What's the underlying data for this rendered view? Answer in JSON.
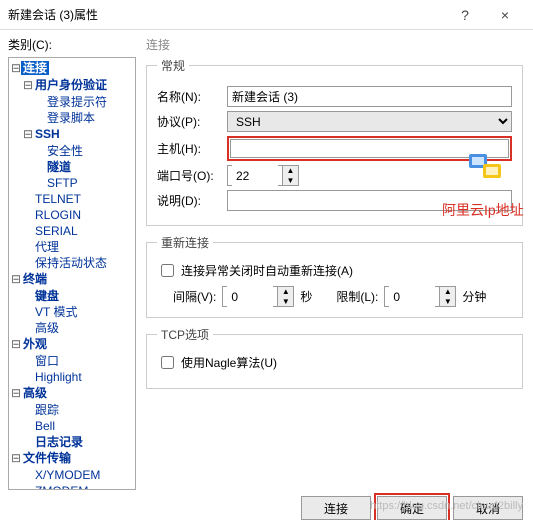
{
  "window": {
    "title": "新建会话 (3)属性",
    "help": "?",
    "close": "×"
  },
  "category_label": "类别(C):",
  "tree": {
    "root": [
      {
        "label": "连接",
        "selected": true,
        "bold": true,
        "children": [
          {
            "label": "用户身份验证",
            "bold": true,
            "children": [
              {
                "label": "登录提示符"
              },
              {
                "label": "登录脚本"
              }
            ]
          },
          {
            "label": "SSH",
            "bold": true,
            "children": [
              {
                "label": "安全性"
              },
              {
                "label": "隧道",
                "bold": true
              },
              {
                "label": "SFTP"
              }
            ]
          },
          {
            "label": "TELNET"
          },
          {
            "label": "RLOGIN"
          },
          {
            "label": "SERIAL"
          },
          {
            "label": "代理"
          },
          {
            "label": "保持活动状态"
          }
        ]
      },
      {
        "label": "终端",
        "bold": true,
        "children": [
          {
            "label": "键盘",
            "bold": true
          },
          {
            "label": "VT 模式"
          },
          {
            "label": "高级"
          }
        ]
      },
      {
        "label": "外观",
        "bold": true,
        "children": [
          {
            "label": "窗口"
          },
          {
            "label": "Highlight"
          }
        ]
      },
      {
        "label": "高级",
        "bold": true,
        "children": [
          {
            "label": "跟踪"
          },
          {
            "label": "Bell"
          },
          {
            "label": "日志记录",
            "bold": true
          }
        ]
      },
      {
        "label": "文件传输",
        "bold": true,
        "children": [
          {
            "label": "X/YMODEM"
          },
          {
            "label": "ZMODEM"
          }
        ]
      }
    ]
  },
  "panel": {
    "section_title": "连接",
    "general": {
      "legend": "常规",
      "name_label": "名称(N):",
      "name_value": "新建会话 (3)",
      "proto_label": "协议(P):",
      "proto_value": "SSH",
      "host_label": "主机(H):",
      "host_value": "",
      "port_label": "端口号(O):",
      "port_value": "22",
      "desc_label": "说明(D):",
      "desc_value": ""
    },
    "reconnect": {
      "legend": "重新连接",
      "auto_label": "连接异常关闭时自动重新连接(A)",
      "interval_label": "间隔(V):",
      "interval_value": "0",
      "interval_unit": "秒",
      "limit_label": "限制(L):",
      "limit_value": "0",
      "limit_unit": "分钟"
    },
    "tcp": {
      "legend": "TCP选项",
      "nagle_label": "使用Nagle算法(U)"
    }
  },
  "buttons": {
    "connect": "连接",
    "ok": "确定",
    "cancel": "取消"
  },
  "annotation": "阿里云Ip地址",
  "watermark": "https://blog.csdn.net/cloud2billy"
}
